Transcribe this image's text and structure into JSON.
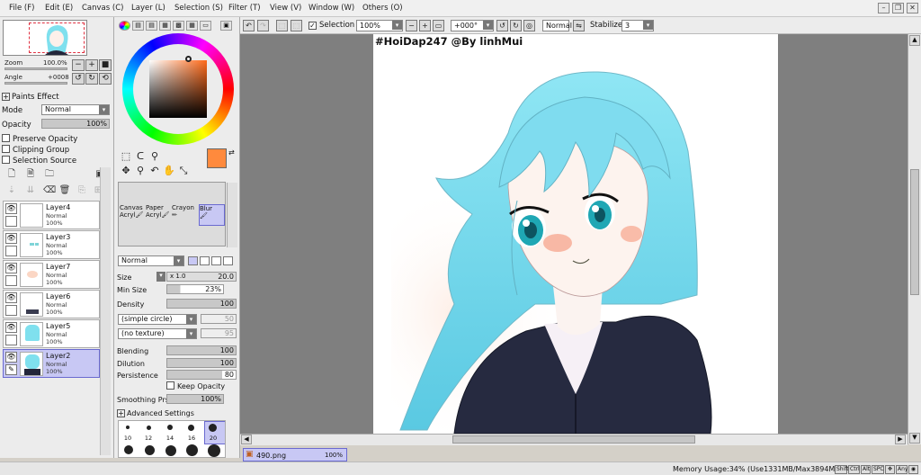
{
  "menu": [
    "File (F)",
    "Edit (E)",
    "Canvas (C)",
    "Layer (L)",
    "Selection (S)",
    "Filter (T)",
    "View (V)",
    "Window (W)",
    "Others (O)"
  ],
  "navigator": {
    "zoom_label": "Zoom",
    "zoom_value": "100.0%",
    "angle_label": "Angle",
    "angle_value": "+0008"
  },
  "layer_props": {
    "paints_effect": "Paints Effect",
    "mode_label": "Mode",
    "mode_value": "Normal",
    "opacity_label": "Opacity",
    "opacity_value": "100%",
    "preserve_opacity": "Preserve Opacity",
    "clipping_group": "Clipping Group",
    "selection_source": "Selection Source"
  },
  "layers": [
    {
      "name": "Layer4",
      "mode": "Normal",
      "opacity": "100%"
    },
    {
      "name": "Layer3",
      "mode": "Normal",
      "opacity": "100%"
    },
    {
      "name": "Layer7",
      "mode": "Normal",
      "opacity": "100%"
    },
    {
      "name": "Layer6",
      "mode": "Normal",
      "opacity": "100%"
    },
    {
      "name": "Layer5",
      "mode": "Normal",
      "opacity": "100%"
    },
    {
      "name": "Layer2",
      "mode": "Normal",
      "opacity": "100%",
      "selected": true
    }
  ],
  "colors": {
    "primary": "#ff8a3d",
    "secondary": "#ffffff",
    "selection_accent": "#c8c8f4",
    "workspace": "#7f7f7f"
  },
  "tools": [
    {
      "line1": "Canvas",
      "line2": "Acryl"
    },
    {
      "line1": "Paper",
      "line2": "Acryl"
    },
    {
      "line1": "Crayon",
      "line2": ""
    },
    {
      "line1": "Blur",
      "line2": "",
      "selected": true
    }
  ],
  "brush": {
    "blend_mode": "Normal",
    "size_label": "Size",
    "size_mult": "x 1.0",
    "size_value": "20.0",
    "min_size_label": "Min Size",
    "min_size_value": "23%",
    "density_label": "Density",
    "density_value": "100",
    "shape": "(simple circle)",
    "shape_value": "50",
    "texture": "(no texture)",
    "texture_value": "95",
    "blending_label": "Blending",
    "blending_value": "100",
    "dilution_label": "Dilution",
    "dilution_value": "100",
    "persistence_label": "Persistence",
    "persistence_value": "80",
    "keep_opacity": "Keep Opacity",
    "smoothing_label": "Smoothing Prs",
    "smoothing_value": "100%",
    "advanced": "Advanced Settings",
    "sizes": [
      "10",
      "12",
      "14",
      "16",
      "20"
    ]
  },
  "toolbar": {
    "selection_label": "Selection",
    "zoom": "100%",
    "rotation": "+000°",
    "blend": "Normal",
    "stabilizer_label": "Stabilizer",
    "stabilizer_value": "3"
  },
  "canvas": {
    "watermark": "#HoiDap247 @By linhMui"
  },
  "file_tab": {
    "name": "490.png",
    "zoom": "100%"
  },
  "status": {
    "memory": "Memory Usage:34% (Use1331MB/Max3894MB)",
    "keys": [
      "Shift",
      "Ctrl",
      "Alt",
      "SPC",
      "✥",
      "Any"
    ]
  }
}
